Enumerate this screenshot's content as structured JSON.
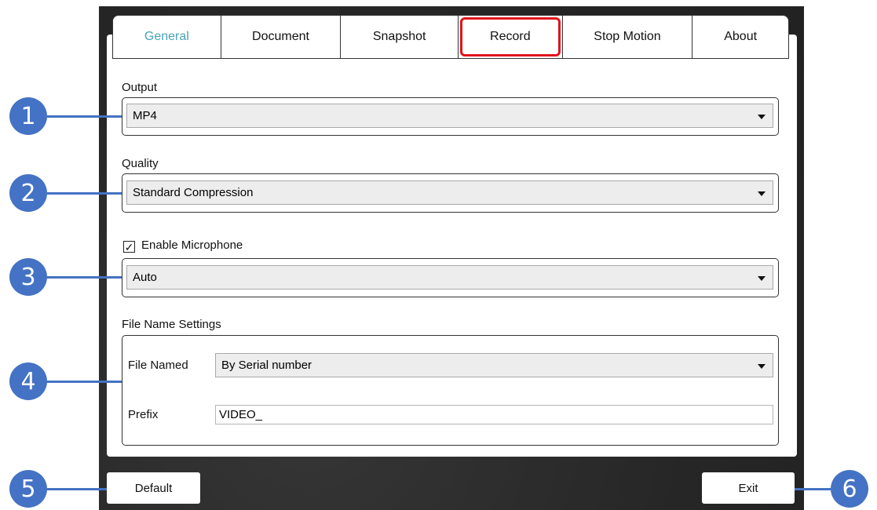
{
  "tabs": [
    {
      "label": "General"
    },
    {
      "label": "Document"
    },
    {
      "label": "Snapshot"
    },
    {
      "label": "Record"
    },
    {
      "label": "Stop Motion"
    },
    {
      "label": "About"
    }
  ],
  "output": {
    "label": "Output",
    "value": "MP4"
  },
  "quality": {
    "label": "Quality",
    "value": "Standard Compression"
  },
  "microphone": {
    "checkbox_label": "Enable Microphone",
    "checked_glyph": "✓",
    "value": "Auto"
  },
  "file_name_settings": {
    "label": "File Name Settings",
    "file_named_label": "File Named",
    "file_named_value": "By Serial number",
    "prefix_label": "Prefix",
    "prefix_value": "VIDEO_"
  },
  "buttons": {
    "default_label": "Default",
    "exit_label": "Exit"
  },
  "callouts": [
    "1",
    "2",
    "3",
    "4",
    "5",
    "6"
  ],
  "colors": {
    "active_tab": "#4aa3b8",
    "highlight": "#e0151b",
    "callout": "#4472c4"
  }
}
